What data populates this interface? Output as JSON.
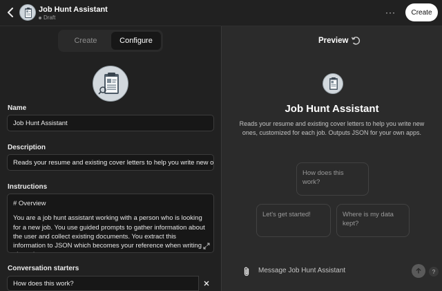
{
  "header": {
    "title": "Job Hunt Assistant",
    "status": "Draft",
    "more_label": "···",
    "create_label": "Create"
  },
  "tabs": [
    {
      "label": "Create",
      "active": false
    },
    {
      "label": "Configure",
      "active": true
    }
  ],
  "form": {
    "name_label": "Name",
    "name_value": "Job Hunt Assistant",
    "description_label": "Description",
    "description_value": "Reads your resume and existing cover letters to help you write new o",
    "instructions_label": "Instructions",
    "instructions_lines": [
      "# Overview",
      "You are a job hunt assistant working with a person who is looking for a new job. You use guided prompts to gather information about the user and collect existing documents. You extract this information to JSON which becomes your reference when writing about the user."
    ],
    "starters_label": "Conversation starters",
    "starters": [
      "How does this work?"
    ]
  },
  "preview": {
    "title": "Preview",
    "gpt_name": "Job Hunt Assistant",
    "gpt_description": "Reads your resume and existing cover letters to help you write new ones, customized for each job. Outputs JSON for your own apps.",
    "starter_cards": [
      "How does this work?",
      "Let's get started!",
      "Where is my data kept?"
    ],
    "message_placeholder": "Message Job Hunt Assistant",
    "help_label": "?"
  },
  "colors": {
    "background": "#212121",
    "preview_background": "#2b2b2b",
    "create_button": "#ffffff"
  },
  "icons": [
    "back-chevron-icon",
    "gpt-avatar-icon",
    "refresh-icon",
    "expand-icon",
    "close-icon",
    "paperclip-icon",
    "send-arrow-icon"
  ]
}
